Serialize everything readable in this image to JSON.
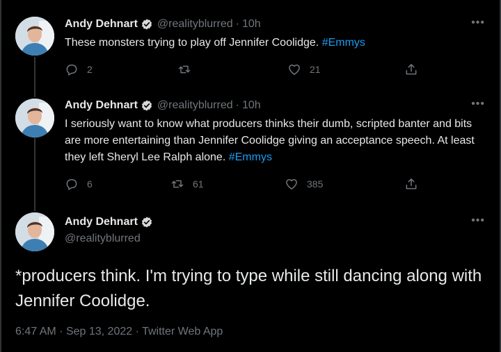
{
  "tweets": [
    {
      "author_name": "Andy Dehnart",
      "handle": "@realityblurred",
      "separator": "·",
      "time": "10h",
      "text": "These monsters trying to play off Jennifer Coolidge.",
      "hashtag": "#Emmys",
      "reply_count": "2",
      "retweet_count": "",
      "like_count": "21"
    },
    {
      "author_name": "Andy Dehnart",
      "handle": "@realityblurred",
      "separator": "·",
      "time": "10h",
      "text": "I seriously want to know what producers thinks their dumb, scripted banter and bits are more entertaining than Jennifer Coolidge giving an acceptance speech. At least they left Sheryl Lee Ralph alone.",
      "hashtag": "#Emmys",
      "reply_count": "6",
      "retweet_count": "61",
      "like_count": "385"
    }
  ],
  "main_tweet": {
    "author_name": "Andy Dehnart",
    "handle": "@realityblurred",
    "text": "*producers think. I'm trying to type while still dancing along with Jennifer Coolidge.",
    "timestamp": "6:47 AM",
    "date": "Sep 13, 2022",
    "separator": "·",
    "source": "Twitter Web App"
  },
  "icons": {
    "more": "more-horizontal-icon",
    "verified": "verified-badge-icon",
    "reply": "reply-icon",
    "retweet": "retweet-icon",
    "like": "heart-icon",
    "share": "share-icon"
  },
  "colors": {
    "background": "#000000",
    "text": "#e7e9ea",
    "secondary": "#71767b",
    "accent": "#1d9bf0",
    "thread_line": "#333639"
  }
}
